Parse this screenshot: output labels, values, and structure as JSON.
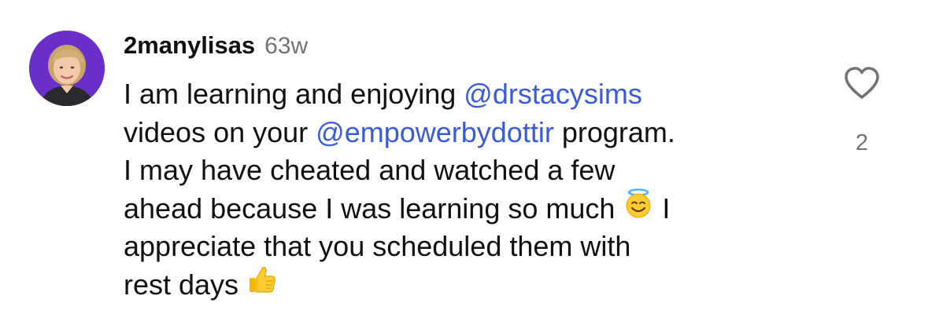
{
  "comment": {
    "username": "2manylisas",
    "timestamp": "63w",
    "lines": [
      [
        {
          "text": "I am learning and enjoying "
        },
        {
          "mention": "@drstacysims"
        }
      ],
      [
        {
          "text": "videos on your "
        },
        {
          "mention": "@empowerbydottir"
        },
        {
          "text": " program."
        }
      ],
      [
        {
          "text": "I may have cheated and watched a few"
        }
      ],
      [
        {
          "text": "ahead because I was learning so much "
        },
        {
          "emoji": "smiling-face-with-halo"
        },
        {
          "text": " I"
        }
      ],
      [
        {
          "text": "appreciate that you scheduled them with"
        }
      ],
      [
        {
          "text": "rest days "
        },
        {
          "emoji": "thumbs-up"
        }
      ]
    ]
  },
  "like": {
    "icon": "heart-outline-icon",
    "count": "2"
  },
  "colors": {
    "mention": "#3b5bdb",
    "muted": "#737373",
    "avatar_bg": "#6b2fc9"
  }
}
